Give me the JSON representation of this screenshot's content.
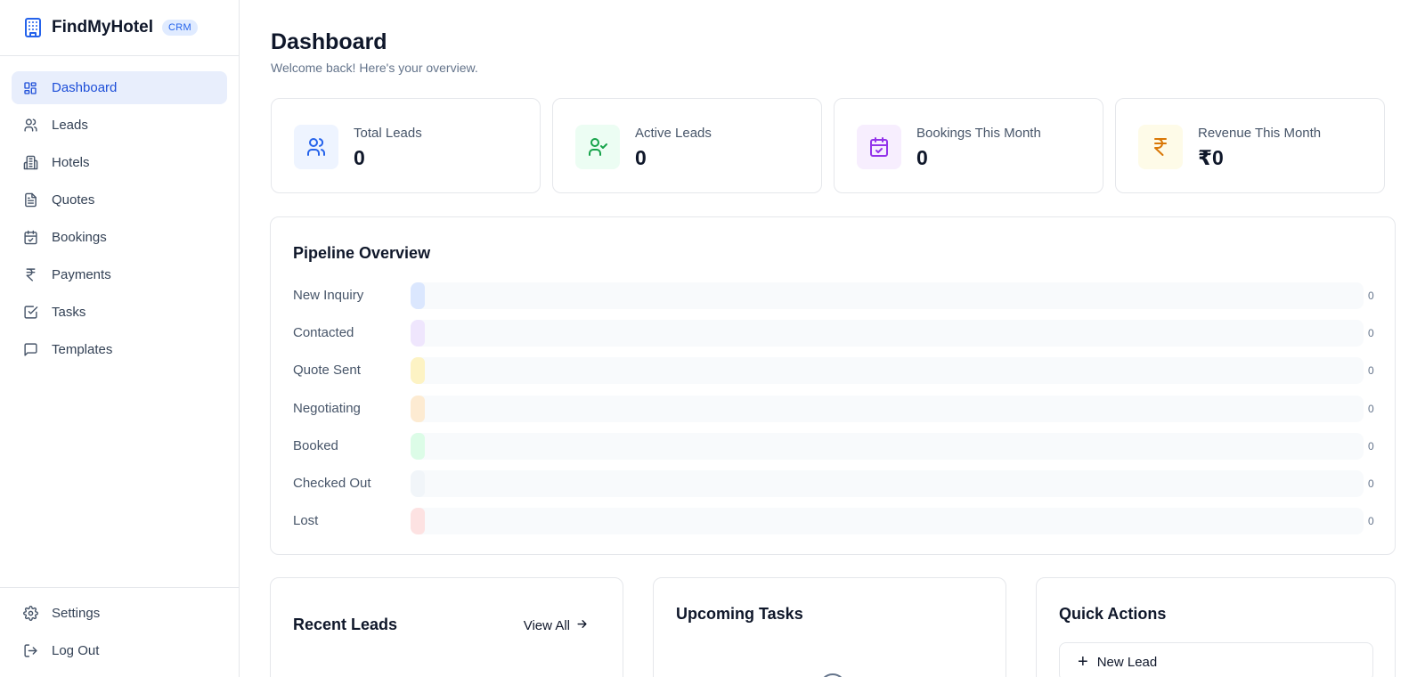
{
  "brand": {
    "name": "FindMyHotel",
    "badge": "CRM",
    "icon": "hotel-building-icon"
  },
  "sidebar": {
    "items": [
      {
        "label": "Dashboard",
        "icon": "layout-grid-icon",
        "active": true
      },
      {
        "label": "Leads",
        "icon": "users-icon",
        "active": false
      },
      {
        "label": "Hotels",
        "icon": "building-icon",
        "active": false
      },
      {
        "label": "Quotes",
        "icon": "document-icon",
        "active": false
      },
      {
        "label": "Bookings",
        "icon": "calendar-check-icon",
        "active": false
      },
      {
        "label": "Payments",
        "icon": "rupee-icon",
        "active": false
      },
      {
        "label": "Tasks",
        "icon": "checkbox-icon",
        "active": false
      },
      {
        "label": "Templates",
        "icon": "message-square-icon",
        "active": false
      }
    ],
    "bottom": [
      {
        "label": "Settings",
        "icon": "gear-icon"
      },
      {
        "label": "Log Out",
        "icon": "logout-icon"
      }
    ]
  },
  "header": {
    "title": "Dashboard",
    "subtitle": "Welcome back! Here's your overview."
  },
  "stats": [
    {
      "label": "Total Leads",
      "value": "0",
      "icon": "users-icon",
      "bg": "#eef4ff",
      "color": "#2563eb"
    },
    {
      "label": "Active Leads",
      "value": "0",
      "icon": "user-check-icon",
      "bg": "#ecfdf3",
      "color": "#16a34a"
    },
    {
      "label": "Bookings This Month",
      "value": "0",
      "icon": "calendar-check-icon",
      "bg": "#f7eefe",
      "color": "#9333ea"
    },
    {
      "label": "Revenue This Month",
      "value": "₹0",
      "icon": "rupee-icon",
      "bg": "#fefbe8",
      "color": "#d97706"
    }
  ],
  "pipeline": {
    "title": "Pipeline Overview",
    "stages": [
      {
        "label": "New Inquiry",
        "count": 0,
        "color": "#dbe7fe"
      },
      {
        "label": "Contacted",
        "count": 0,
        "color": "#efe6fd"
      },
      {
        "label": "Quote Sent",
        "count": 0,
        "color": "#fdf3c4"
      },
      {
        "label": "Negotiating",
        "count": 0,
        "color": "#fdebd2"
      },
      {
        "label": "Booked",
        "count": 0,
        "color": "#dcfce7"
      },
      {
        "label": "Checked Out",
        "count": 0,
        "color": "#f1f5f9"
      },
      {
        "label": "Lost",
        "count": 0,
        "color": "#fde2e2"
      }
    ]
  },
  "recent_leads": {
    "title": "Recent Leads",
    "view_all": "View All"
  },
  "upcoming_tasks": {
    "title": "Upcoming Tasks"
  },
  "quick_actions": {
    "title": "Quick Actions",
    "new_lead": "New Lead"
  }
}
